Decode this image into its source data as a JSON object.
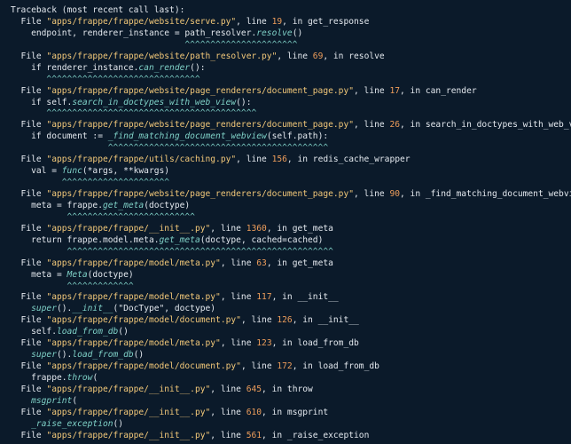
{
  "theme": {
    "background": "#0b1a2a",
    "text": "#e3e8ee",
    "string": "#f2c879",
    "number": "#ed9d5b",
    "function": "#7fd1c7"
  },
  "traceback_lines": [
    [
      {
        "t": "Traceback (most recent call last):"
      }
    ],
    [
      {
        "t": "  File "
      },
      {
        "t": "\"apps/frappe/frappe/website/serve.py\"",
        "c": "s"
      },
      {
        "t": ", line "
      },
      {
        "t": "19",
        "c": "n"
      },
      {
        "t": ", in get_response"
      }
    ],
    [
      {
        "t": "    endpoint, renderer_instance = path_resolver."
      },
      {
        "t": "resolve",
        "c": "fn"
      },
      {
        "t": "()"
      }
    ],
    [
      {
        "t": "                                  ^^^^^^^^^^^^^^^^^^^^^^",
        "c": "car"
      }
    ],
    [
      {
        "t": "  File "
      },
      {
        "t": "\"apps/frappe/frappe/website/path_resolver.py\"",
        "c": "s"
      },
      {
        "t": ", line "
      },
      {
        "t": "69",
        "c": "n"
      },
      {
        "t": ", in resolve"
      }
    ],
    [
      {
        "t": "    if renderer_instance."
      },
      {
        "t": "can_render",
        "c": "fn"
      },
      {
        "t": "():"
      }
    ],
    [
      {
        "t": "       ^^^^^^^^^^^^^^^^^^^^^^^^^^^^^^",
        "c": "car"
      }
    ],
    [
      {
        "t": "  File "
      },
      {
        "t": "\"apps/frappe/frappe/website/page_renderers/document_page.py\"",
        "c": "s"
      },
      {
        "t": ", line "
      },
      {
        "t": "17",
        "c": "n"
      },
      {
        "t": ", in can_render"
      }
    ],
    [
      {
        "t": "    if self."
      },
      {
        "t": "search_in_doctypes_with_web_view",
        "c": "fn"
      },
      {
        "t": "():"
      }
    ],
    [
      {
        "t": "       ^^^^^^^^^^^^^^^^^^^^^^^^^^^^^^^^^^^^^^^^^",
        "c": "car"
      }
    ],
    [
      {
        "t": "  File "
      },
      {
        "t": "\"apps/frappe/frappe/website/page_renderers/document_page.py\"",
        "c": "s"
      },
      {
        "t": ", line "
      },
      {
        "t": "26",
        "c": "n"
      },
      {
        "t": ", in search_in_doctypes_with_web_view"
      }
    ],
    [
      {
        "t": "    if document := "
      },
      {
        "t": "_find_matching_document_webview",
        "c": "fn"
      },
      {
        "t": "(self.path):"
      }
    ],
    [
      {
        "t": "                   ^^^^^^^^^^^^^^^^^^^^^^^^^^^^^^^^^^^^^^^^^^^",
        "c": "car"
      }
    ],
    [
      {
        "t": "  File "
      },
      {
        "t": "\"apps/frappe/frappe/utils/caching.py\"",
        "c": "s"
      },
      {
        "t": ", line "
      },
      {
        "t": "156",
        "c": "n"
      },
      {
        "t": ", in redis_cache_wrapper"
      }
    ],
    [
      {
        "t": "    val = "
      },
      {
        "t": "func",
        "c": "fn"
      },
      {
        "t": "(*args, **kwargs)"
      }
    ],
    [
      {
        "t": "          ^^^^^^^^^^^^^^^^^^^^^",
        "c": "car"
      }
    ],
    [
      {
        "t": "  File "
      },
      {
        "t": "\"apps/frappe/frappe/website/page_renderers/document_page.py\"",
        "c": "s"
      },
      {
        "t": ", line "
      },
      {
        "t": "90",
        "c": "n"
      },
      {
        "t": ", in _find_matching_document_webview"
      }
    ],
    [
      {
        "t": "    meta = frappe."
      },
      {
        "t": "get_meta",
        "c": "fn"
      },
      {
        "t": "(doctype)"
      }
    ],
    [
      {
        "t": "           ^^^^^^^^^^^^^^^^^^^^^^^^^",
        "c": "car"
      }
    ],
    [
      {
        "t": "  File "
      },
      {
        "t": "\"apps/frappe/frappe/__init__.py\"",
        "c": "s"
      },
      {
        "t": ", line "
      },
      {
        "t": "1360",
        "c": "n"
      },
      {
        "t": ", in get_meta"
      }
    ],
    [
      {
        "t": "    return frappe.model.meta."
      },
      {
        "t": "get_meta",
        "c": "fn"
      },
      {
        "t": "(doctype, cached=cached)"
      }
    ],
    [
      {
        "t": "           ^^^^^^^^^^^^^^^^^^^^^^^^^^^^^^^^^^^^^^^^^^^^^^^^^^^^",
        "c": "car"
      }
    ],
    [
      {
        "t": "  File "
      },
      {
        "t": "\"apps/frappe/frappe/model/meta.py\"",
        "c": "s"
      },
      {
        "t": ", line "
      },
      {
        "t": "63",
        "c": "n"
      },
      {
        "t": ", in get_meta"
      }
    ],
    [
      {
        "t": "    meta = "
      },
      {
        "t": "Meta",
        "c": "fn"
      },
      {
        "t": "(doctype)"
      }
    ],
    [
      {
        "t": "           ^^^^^^^^^^^^^",
        "c": "car"
      }
    ],
    [
      {
        "t": "  File "
      },
      {
        "t": "\"apps/frappe/frappe/model/meta.py\"",
        "c": "s"
      },
      {
        "t": ", line "
      },
      {
        "t": "117",
        "c": "n"
      },
      {
        "t": ", in __init__"
      }
    ],
    [
      {
        "t": "    "
      },
      {
        "t": "super",
        "c": "fn"
      },
      {
        "t": "()."
      },
      {
        "t": "__init__",
        "c": "fn"
      },
      {
        "t": "(\"DocType\", doctype)"
      }
    ],
    [
      {
        "t": "  File "
      },
      {
        "t": "\"apps/frappe/frappe/model/document.py\"",
        "c": "s"
      },
      {
        "t": ", line "
      },
      {
        "t": "126",
        "c": "n"
      },
      {
        "t": ", in __init__"
      }
    ],
    [
      {
        "t": "    self."
      },
      {
        "t": "load_from_db",
        "c": "fn"
      },
      {
        "t": "()"
      }
    ],
    [
      {
        "t": "  File "
      },
      {
        "t": "\"apps/frappe/frappe/model/meta.py\"",
        "c": "s"
      },
      {
        "t": ", line "
      },
      {
        "t": "123",
        "c": "n"
      },
      {
        "t": ", in load_from_db"
      }
    ],
    [
      {
        "t": "    "
      },
      {
        "t": "super",
        "c": "fn"
      },
      {
        "t": "()."
      },
      {
        "t": "load_from_db",
        "c": "fn"
      },
      {
        "t": "()"
      }
    ],
    [
      {
        "t": "  File "
      },
      {
        "t": "\"apps/frappe/frappe/model/document.py\"",
        "c": "s"
      },
      {
        "t": ", line "
      },
      {
        "t": "172",
        "c": "n"
      },
      {
        "t": ", in load_from_db"
      }
    ],
    [
      {
        "t": "    frappe."
      },
      {
        "t": "throw",
        "c": "fn"
      },
      {
        "t": "("
      }
    ],
    [
      {
        "t": "  File "
      },
      {
        "t": "\"apps/frappe/frappe/__init__.py\"",
        "c": "s"
      },
      {
        "t": ", line "
      },
      {
        "t": "645",
        "c": "n"
      },
      {
        "t": ", in throw"
      }
    ],
    [
      {
        "t": "    "
      },
      {
        "t": "msgprint",
        "c": "fn"
      },
      {
        "t": "("
      }
    ],
    [
      {
        "t": "  File "
      },
      {
        "t": "\"apps/frappe/frappe/__init__.py\"",
        "c": "s"
      },
      {
        "t": ", line "
      },
      {
        "t": "610",
        "c": "n"
      },
      {
        "t": ", in msgprint"
      }
    ],
    [
      {
        "t": "    "
      },
      {
        "t": "_raise_exception",
        "c": "fn"
      },
      {
        "t": "()"
      }
    ],
    [
      {
        "t": "  File "
      },
      {
        "t": "\"apps/frappe/frappe/__init__.py\"",
        "c": "s"
      },
      {
        "t": ", line "
      },
      {
        "t": "561",
        "c": "n"
      },
      {
        "t": ", in _raise_exception"
      }
    ]
  ]
}
